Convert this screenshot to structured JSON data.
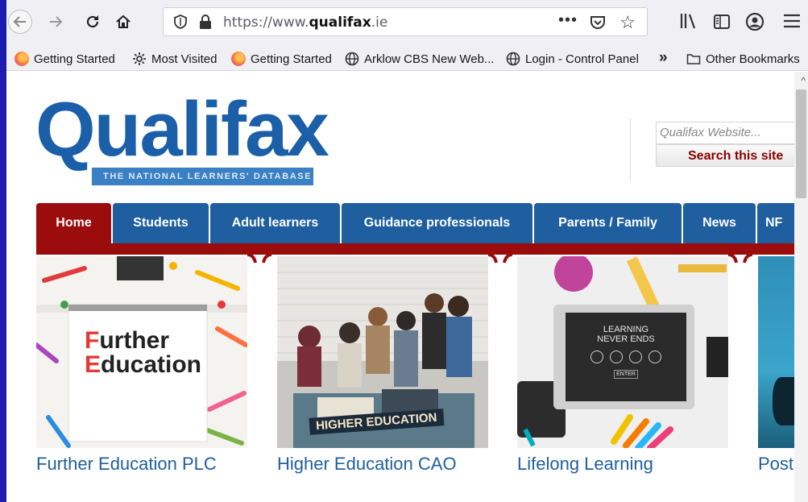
{
  "browser": {
    "url_prefix": "https://www.",
    "url_domain": "qualifax",
    "url_suffix": ".ie",
    "more_label": "•••"
  },
  "bookmarks": [
    {
      "label": "Getting Started",
      "icon": "firefox-icon"
    },
    {
      "label": "Most Visited",
      "icon": "gear-icon"
    },
    {
      "label": "Getting Started",
      "icon": "firefox-icon"
    },
    {
      "label": "Arklow CBS New Web...",
      "icon": "globe-icon"
    },
    {
      "label": "Login - Control Panel",
      "icon": "globe-icon"
    }
  ],
  "other_bookmarks": "Other Bookmarks",
  "site": {
    "logo_word": "Qualifax",
    "logo_tagline": "THE NATIONAL LEARNERS' DATABASE",
    "search_placeholder": "Qualifax Website...",
    "search_button": "Search this site",
    "nav": [
      "Home",
      "Students",
      "Adult learners",
      "Guidance professionals",
      "Parents / Family",
      "News",
      "NF"
    ],
    "cards": [
      {
        "caption": "Further Education PLC",
        "image_text": [
          "Further",
          "Education"
        ]
      },
      {
        "caption": "Higher Education CAO",
        "image_text": [
          "HIGHER EDUCATION"
        ]
      },
      {
        "caption": "Lifelong Learning",
        "image_text": [
          "LEARNING",
          "NEVER ENDS",
          "ENTER"
        ]
      },
      {
        "caption": "Post",
        "image_text": []
      }
    ]
  },
  "colors": {
    "brand_blue": "#1f5fa0",
    "brand_red": "#9b0d0d"
  }
}
